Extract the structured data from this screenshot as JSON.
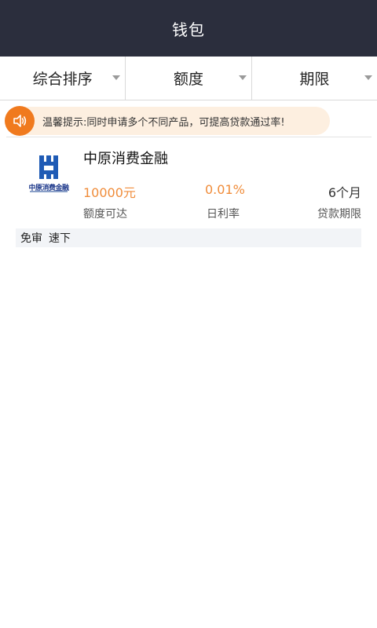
{
  "header": {
    "title": "钱包"
  },
  "filters": [
    {
      "label": "综合排序"
    },
    {
      "label": "额度"
    },
    {
      "label": "期限"
    }
  ],
  "notice": {
    "icon": "speaker-icon",
    "text": "温馨提示:同时申请多个不同产品，可提高贷款通过率!",
    "accent": "#f07a1e",
    "background": "#fdefe0"
  },
  "products": [
    {
      "logo_text": "中原消费金融",
      "name": "中原消费金融",
      "amount": "10000元",
      "amount_label": "额度可达",
      "rate": "0.01%",
      "rate_label": "日利率",
      "term": "6个月",
      "term_label": "贷款期限",
      "tags": [
        "免审",
        "速下"
      ]
    }
  ],
  "colors": {
    "header_bg": "#2b2e3d",
    "highlight": "#f08c3a"
  }
}
